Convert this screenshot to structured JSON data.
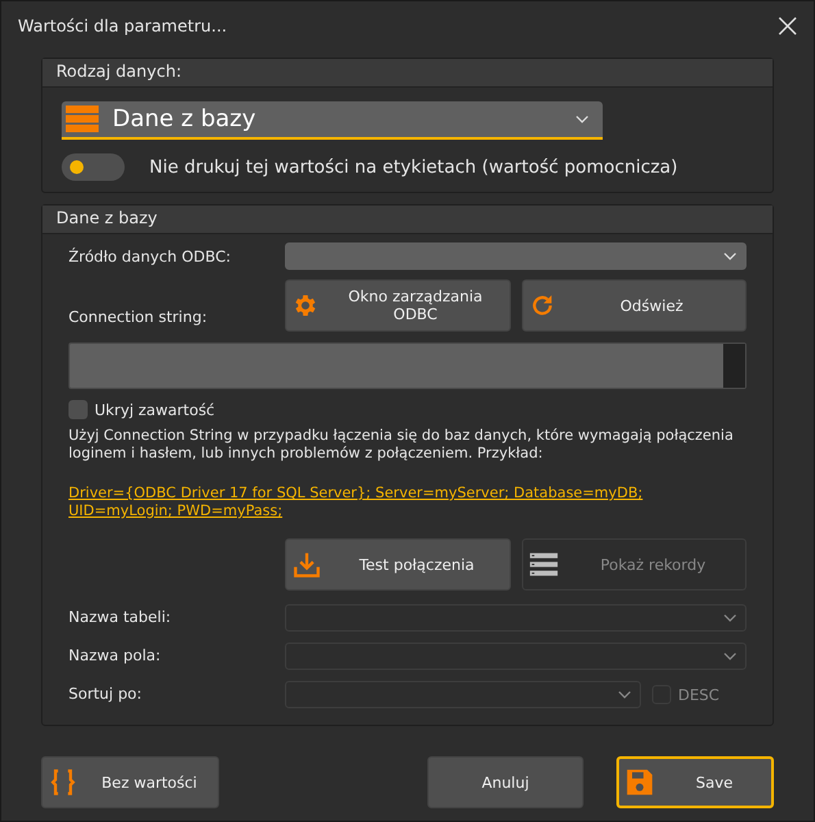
{
  "window": {
    "title": "Wartości dla parametru..."
  },
  "data_type": {
    "header": "Rodzaj danych:",
    "dropdown": {
      "value": "Dane z bazy"
    },
    "toggle": {
      "on": false,
      "label": "Nie drukuj tej wartości na etykietach (wartość pomocnicza)"
    }
  },
  "database": {
    "header": "Dane z bazy",
    "odbc_source": {
      "label": "Źródło danych ODBC:",
      "disabled": false
    },
    "odbc_buttons": [
      {
        "kind": "gear",
        "label": "Okno zarządzania ODBC",
        "disabled": false
      },
      {
        "kind": "refresh",
        "label": "Odśwież",
        "disabled": false
      }
    ],
    "connection_string": {
      "label": "Connection string:"
    },
    "hide_content": {
      "label": "Ukryj zawartość",
      "checked": false
    },
    "info": "Użyj Connection String w przypadku łączenia się do baz danych, które wymagają połączenia loginem i hasłem, lub innych problemów z połączeniem. Przykład:",
    "example_link": "Driver={ODBC Driver 17 for SQL Server}; Server=myServer; Database=myDB; UID=myLogin; PWD=myPass;",
    "action_buttons": [
      {
        "kind": "download",
        "label": "Test połączenia",
        "disabled": false
      },
      {
        "kind": "list",
        "label": "Pokaż rekordy",
        "disabled": true
      }
    ],
    "fields": [
      {
        "label": "Nazwa tabeli:",
        "disabled": true
      },
      {
        "label": "Nazwa pola:",
        "disabled": true
      },
      {
        "label": "Sortuj po:",
        "disabled": true,
        "desc": {
          "label": "DESC",
          "checked": false,
          "disabled": true
        }
      }
    ]
  },
  "buttons": [
    {
      "kind": "braces",
      "label": "Bez wartości",
      "selected": false
    },
    {
      "kind": "none",
      "label": "Anuluj",
      "selected": false
    },
    {
      "kind": "save",
      "label": "Save",
      "selected": true
    }
  ]
}
